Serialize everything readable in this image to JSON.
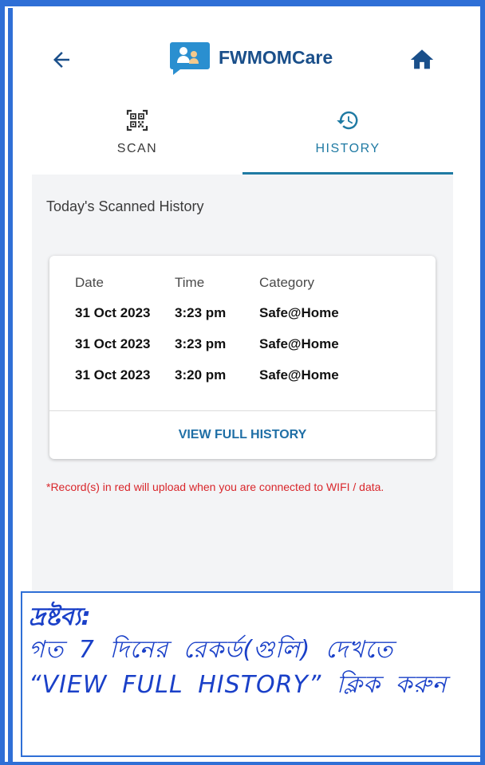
{
  "header": {
    "title": "FWMOMCare",
    "back_icon": "arrow-left-icon",
    "home_icon": "home-icon",
    "logo_icon": "mother-child-logo"
  },
  "tabs": [
    {
      "label": "SCAN",
      "icon": "qr-code-icon",
      "active": false
    },
    {
      "label": "HISTORY",
      "icon": "history-icon",
      "active": true
    }
  ],
  "history": {
    "title": "Today's Scanned History",
    "columns": [
      "Date",
      "Time",
      "Category"
    ],
    "rows": [
      {
        "date": "31 Oct 2023",
        "time": "3:23 pm",
        "category": "Safe@Home"
      },
      {
        "date": "31 Oct 2023",
        "time": "3:23 pm",
        "category": "Safe@Home"
      },
      {
        "date": "31 Oct 2023",
        "time": "3:20 pm",
        "category": "Safe@Home"
      }
    ],
    "view_full_label": "VIEW FULL HISTORY",
    "notice": "*Record(s) in red will upload when you are connected to WIFI / data."
  },
  "note": {
    "heading": "দ্রষ্টব্য:",
    "body": "গত 7 দিনের রেকর্ড(গুলি) দেখতে “VIEW FULL HISTORY” ক্লিক করুন"
  },
  "colors": {
    "accent": "#1f7aa3",
    "title": "#1a4f8a",
    "notice": "#d9262b",
    "note_text": "#1a40c8",
    "frame": "#2f6fd6"
  }
}
